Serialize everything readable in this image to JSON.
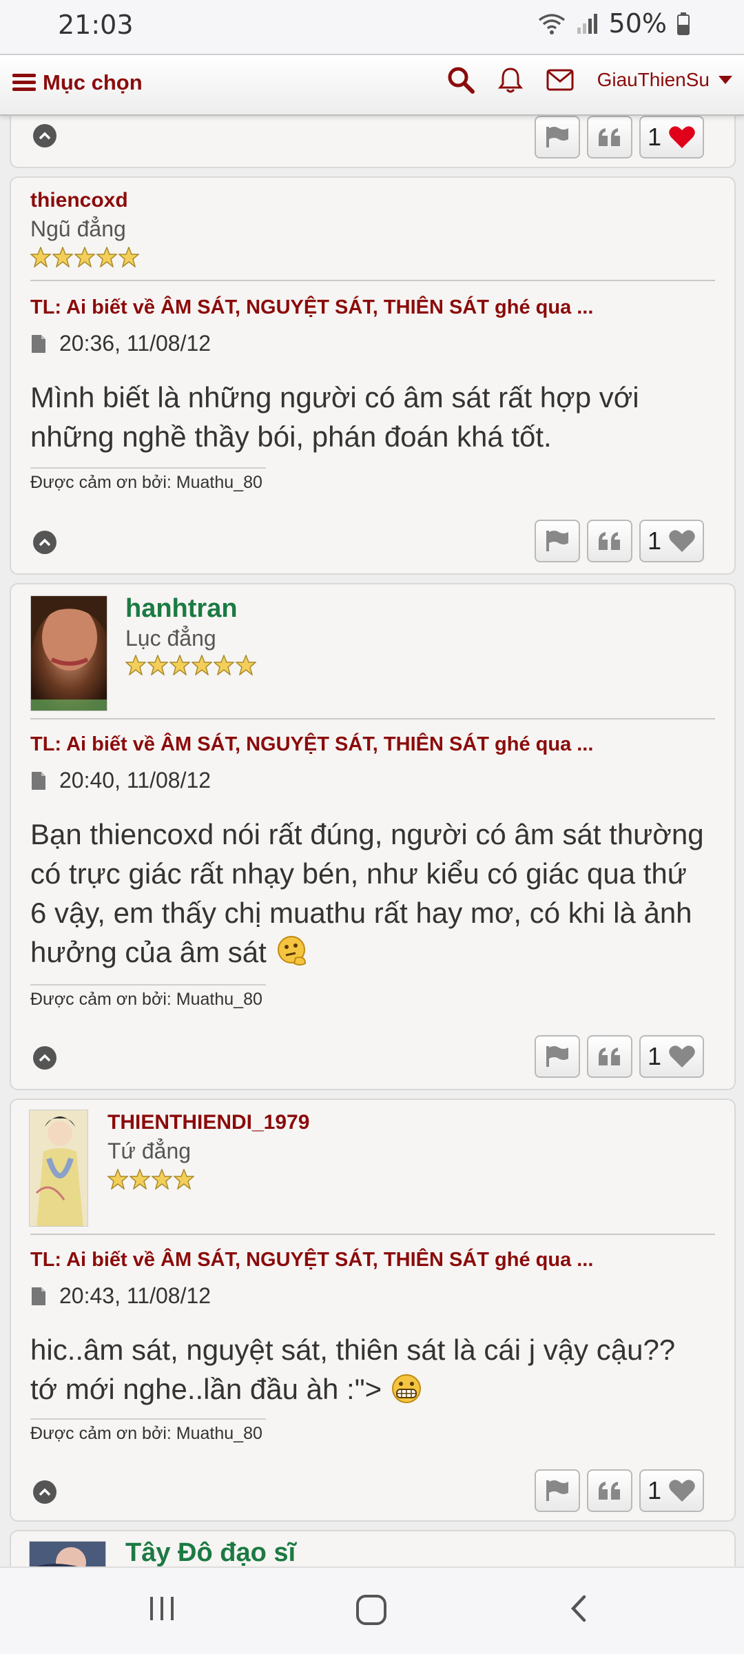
{
  "status": {
    "time": "21:03",
    "battery": "50%"
  },
  "nav": {
    "menu_label": "Mục chọn",
    "username": "GiauThienSu"
  },
  "colors": {
    "accent": "#8b0b0b",
    "green_name": "#1c7a43",
    "heart_red": "#e0001a"
  },
  "posts": [
    {
      "likes": "1"
    },
    {
      "username": "thiencoxd",
      "rank": "Ngũ đẳng",
      "stars": 5,
      "title": "TL: Ai biết về ÂM SÁT, NGUYỆT SÁT, THIÊN SÁT ghé qua ...",
      "time": "20:36, 11/08/12",
      "body": "Mình biết là những người có âm sát rất hợp với những nghề thầy bói, phán đoán khá tốt.",
      "thanks": "Được cảm ơn bởi: Muathu_80",
      "likes": "1"
    },
    {
      "username": "hanhtran",
      "rank": "Lục đẳng",
      "stars": 6,
      "title": "TL: Ai biết về ÂM SÁT, NGUYỆT SÁT, THIÊN SÁT ghé qua ...",
      "time": "20:40, 11/08/12",
      "body": "Bạn thiencoxd nói rất đúng, người có âm sát thường có trực giác rất nhạy bén, như kiểu có giác qua thứ 6 vậy, em thấy chị muathu rất hay mơ, có khi là ảnh hưởng của âm sát",
      "thanks": "Được cảm ơn bởi: Muathu_80",
      "likes": "1"
    },
    {
      "username": "THIENTHIENDI_1979",
      "rank": "Tứ đẳng",
      "stars": 4,
      "title": "TL: Ai biết về ÂM SÁT, NGUYỆT SÁT, THIÊN SÁT ghé qua ...",
      "time": "20:43, 11/08/12",
      "body": "hic..âm sát, nguyệt sát, thiên sát là cái j vậy cậu?? tớ mới nghe..lần đầu àh :\">",
      "thanks": "Được cảm ơn bởi: Muathu_80",
      "likes": "1"
    },
    {
      "username": "Tây Đô đạo sĩ"
    }
  ]
}
